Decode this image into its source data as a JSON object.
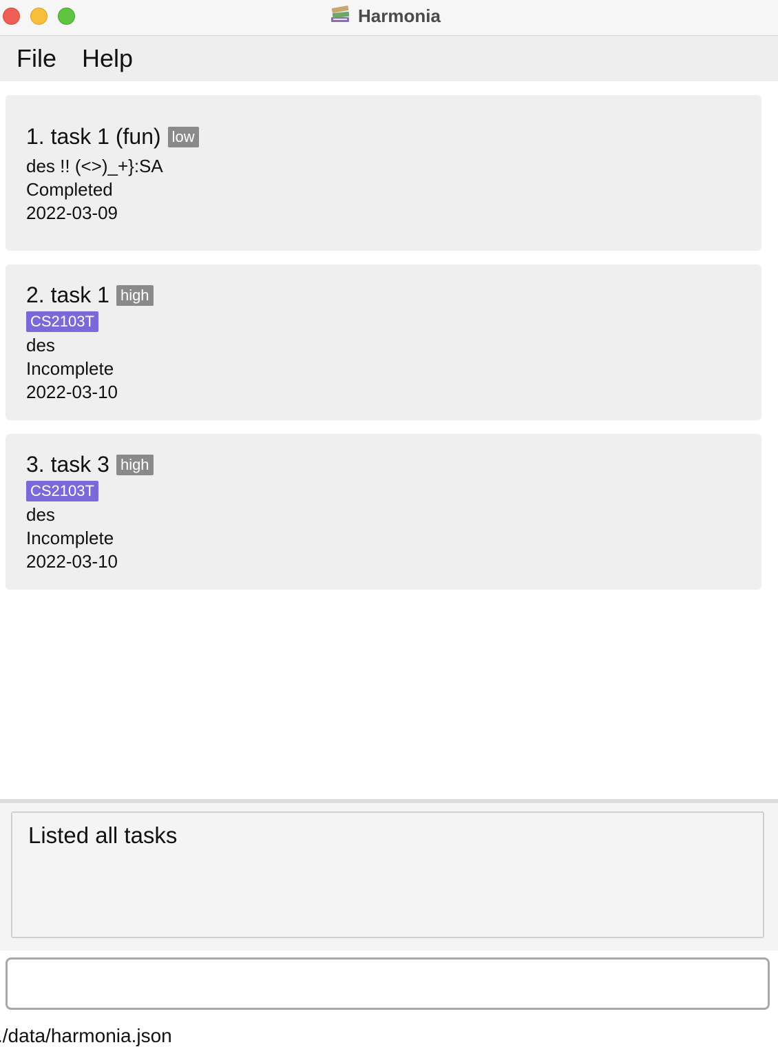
{
  "window": {
    "title": "Harmonia",
    "app_icon": "books-icon"
  },
  "menu": {
    "file": "File",
    "help": "Help"
  },
  "tasks": [
    {
      "title": "1. task 1 (fun)",
      "priority": "low",
      "tag": "",
      "description": "des !! (<>)_+}:SA",
      "status": "Completed",
      "date": "2022-03-09"
    },
    {
      "title": "2. task 1",
      "priority": "high",
      "tag": "CS2103T",
      "description": "des",
      "status": "Incomplete",
      "date": "2022-03-10"
    },
    {
      "title": "3. task 3",
      "priority": "high",
      "tag": "CS2103T",
      "description": "des",
      "status": "Incomplete",
      "date": "2022-03-10"
    }
  ],
  "result": {
    "message": "Listed all tasks"
  },
  "command": {
    "value": "",
    "placeholder": ""
  },
  "status_bar": {
    "path": "./data/harmonia.json"
  },
  "colors": {
    "priority_badge": "#8a8a8a",
    "tag_badge": "#7b69d9",
    "card_bg": "#efefef"
  }
}
